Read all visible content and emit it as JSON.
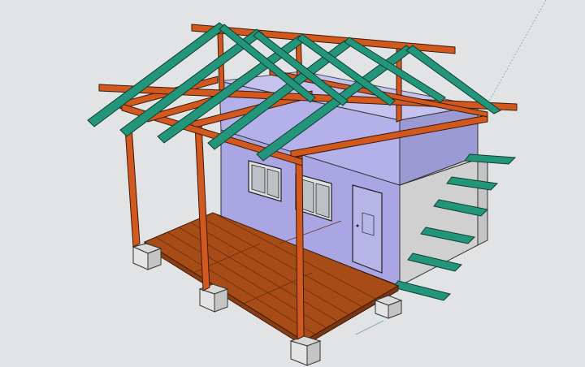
{
  "viewport": {
    "background_color": "#e2e3e5"
  },
  "model": {
    "colors": {
      "posts_and_beams": "#d1581f",
      "rafters_and_steps": "#23957a",
      "deck": "#a74c17",
      "wall_glass": "#b1aee8",
      "wall_glass_dark": "#9290c8",
      "concrete_footing": "#d9d9d9",
      "concrete_wall": "#cfd0cf",
      "window_glass": "#bcc1c6",
      "edge_lines": "#1f1f1f"
    }
  }
}
